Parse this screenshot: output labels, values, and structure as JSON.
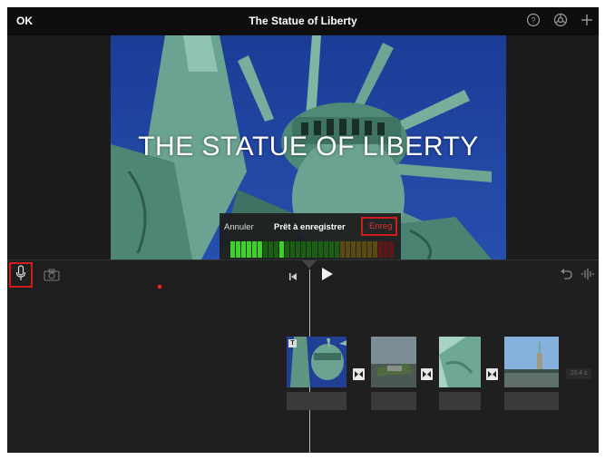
{
  "topbar": {
    "ok_label": "OK",
    "title": "The Statue of Liberty",
    "icons": [
      "help-icon",
      "settings-icon",
      "add-icon"
    ]
  },
  "viewer": {
    "title_overlay": "THE STATUE OF LIBERTY"
  },
  "recording": {
    "cancel_label": "Annuler",
    "status_label": "Prêt à enregistrer",
    "record_label": "Enreg",
    "meter_colors": {
      "active": "#3fd12b",
      "dim": "#1b5f12",
      "warn": "#5a4a0f",
      "hot": "#5e1616"
    }
  },
  "timeline": {
    "icons": [
      "microphone-icon",
      "camera-icon",
      "rewind-icon",
      "play-icon",
      "undo-icon",
      "audio-waveform-icon"
    ],
    "clips": [
      {
        "name": "statue-crown-clip",
        "badge": "T"
      },
      {
        "name": "liberty-island-clip"
      },
      {
        "name": "torch-closeup-clip"
      },
      {
        "name": "statue-harbor-clip"
      }
    ],
    "duration_label": "20.4 s"
  },
  "colors": {
    "accent_red": "#d01c1c",
    "sky_blue": "#1a3f9a",
    "statue_green": "#5e9a86"
  }
}
